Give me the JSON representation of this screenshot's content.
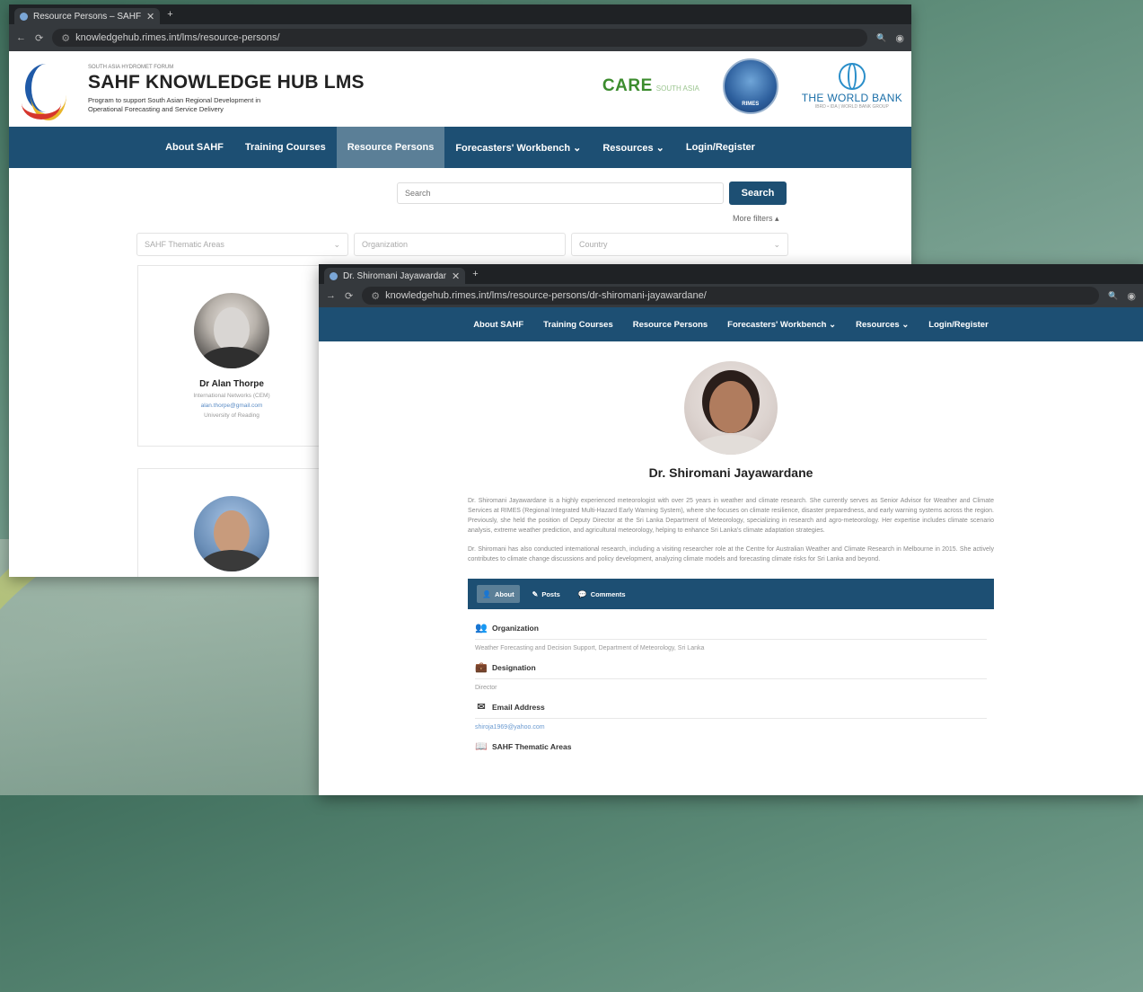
{
  "window1": {
    "tab_title": "Resource Persons – SAHF Know...",
    "url": "knowledgehub.rimes.int/lms/resource-persons/",
    "site": {
      "small_title": "SOUTH ASIA HYDROMET FORUM",
      "title": "SAHF KNOWLEDGE HUB LMS",
      "subtitle": "Program to support South Asian Regional Development in Operational Forecasting and Service Delivery"
    },
    "partners": {
      "care": "CARE",
      "care_sub": "SOUTH ASIA",
      "rimes": "RIMES",
      "wb": "THE WORLD BANK",
      "wb_sub": "IBRD • IDA | WORLD BANK GROUP"
    },
    "nav": [
      "About SAHF",
      "Training Courses",
      "Resource Persons",
      "Forecasters' Workbench ⌄",
      "Resources ⌄",
      "Login/Register"
    ],
    "search": {
      "placeholder": "Search",
      "button": "Search",
      "more_filters": "More filters ▴"
    },
    "filters": {
      "thematic": "SAHF Thematic Areas",
      "organization": "Organization",
      "country": "Country"
    },
    "cards": [
      {
        "name": "Dr Alan Thorpe",
        "lines": [
          "International Networks (CEM)",
          "alan.thorpe@gmail.com",
          "University of Reading"
        ]
      },
      {
        "name": "",
        "lines": []
      }
    ]
  },
  "window2": {
    "tab_title": "Dr. Shiromani Jayawardane | SA...",
    "url": "knowledgehub.rimes.int/lms/resource-persons/dr-shiromani-jayawardane/",
    "nav": [
      "About SAHF",
      "Training Courses",
      "Resource Persons",
      "Forecasters' Workbench ⌄",
      "Resources ⌄",
      "Login/Register"
    ],
    "profile": {
      "name": "Dr. Shiromani Jayawardane",
      "bio": [
        "Dr. Shiromani Jayawardane is a highly experienced meteorologist with over 25 years in weather and climate research. She currently serves as Senior Advisor for Weather and Climate Services at RIMES (Regional Integrated Multi-Hazard Early Warning System), where she focuses on climate resilience, disaster preparedness, and early warning systems across the region. Previously, she held the position of Deputy Director at the Sri Lanka Department of Meteorology, specializing in research and agro-meteorology. Her expertise includes climate scenario analysis, extreme weather prediction, and agricultural meteorology, helping to enhance Sri Lanka's climate adaptation strategies.",
        "Dr. Shiromani has also conducted international research, including a visiting researcher role at the Centre for Australian Weather and Climate Research in Melbourne in 2015. She actively contributes to climate change discussions and policy development, analyzing climate models and forecasting climate risks for Sri Lanka and beyond."
      ],
      "tabs": [
        "About",
        "Posts",
        "Comments"
      ],
      "sections": [
        {
          "label": "Organization",
          "value": "Weather Forecasting and Decision Support, Department of Meteorology, Sri Lanka"
        },
        {
          "label": "Designation",
          "value": "Director"
        },
        {
          "label": "Email Address",
          "value": "shiroja1969@yahoo.com"
        },
        {
          "label": "SAHF Thematic Areas",
          "value": ""
        }
      ]
    }
  },
  "colors": {
    "nav": "#1d4f73",
    "nav_active": "#5b7f97",
    "search_button": "#1d4f73"
  },
  "icons": {
    "tab_close": "✕",
    "new_tab": "+",
    "back": "←",
    "forward": "→",
    "reload": "⟳",
    "site_info": "⚙",
    "search": "🔍",
    "profile": "◉",
    "dropdown": "⌄",
    "about": "👤",
    "posts": "✎",
    "comments": "💬",
    "organization": "👥",
    "designation": "💼",
    "email": "✉",
    "thematic": "📖"
  }
}
